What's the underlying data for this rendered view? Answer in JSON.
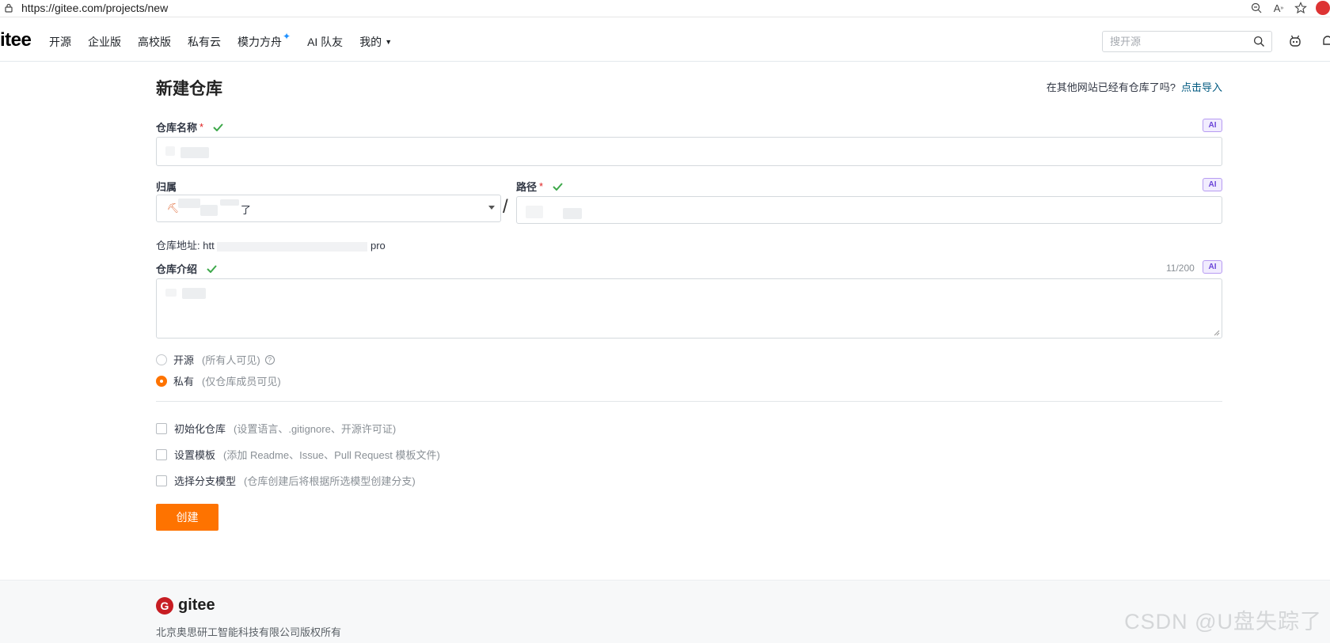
{
  "browser": {
    "url": "https://gitee.com/projects/new"
  },
  "header": {
    "logo": "itee",
    "nav": [
      "开源",
      "企业版",
      "高校版",
      "私有云",
      "模力方舟",
      "AI 队友",
      "我的"
    ],
    "search_placeholder": "搜开源"
  },
  "form": {
    "title": "新建仓库",
    "import_question": "在其他网站已经有仓库了吗?",
    "import_link": "点击导入",
    "repo_name_label": "仓库名称",
    "required_mark": "*",
    "ai_badge": "AI",
    "owner_label": "归属",
    "owner_suffix": "了",
    "path_label": "路径",
    "address_label": "仓库地址:",
    "address_prefix": "htt",
    "address_suffix": "pro",
    "intro_label": "仓库介绍",
    "intro_counter": "11/200",
    "visibility": [
      {
        "label": "开源",
        "hint": "(所有人可见)",
        "selected": false
      },
      {
        "label": "私有",
        "hint": "(仅仓库成员可见)",
        "selected": true
      }
    ],
    "options": [
      {
        "label": "初始化仓库",
        "hint": "(设置语言、.gitignore、开源许可证)"
      },
      {
        "label": "设置模板",
        "hint": "(添加 Readme、Issue、Pull Request 模板文件)"
      },
      {
        "label": "选择分支模型",
        "hint": "(仓库创建后将根据所选模型创建分支)"
      }
    ],
    "create_button": "创建"
  },
  "footer": {
    "logo_text": "gitee",
    "logo_mark": "G",
    "copyright": "北京奥思研工智能科技有限公司版权所有",
    "watermark": "CSDN @U盘失踪了"
  },
  "colors": {
    "accent": "#fe7300",
    "link": "#005980",
    "success": "#3da84a",
    "ai": "#6b45d8"
  }
}
